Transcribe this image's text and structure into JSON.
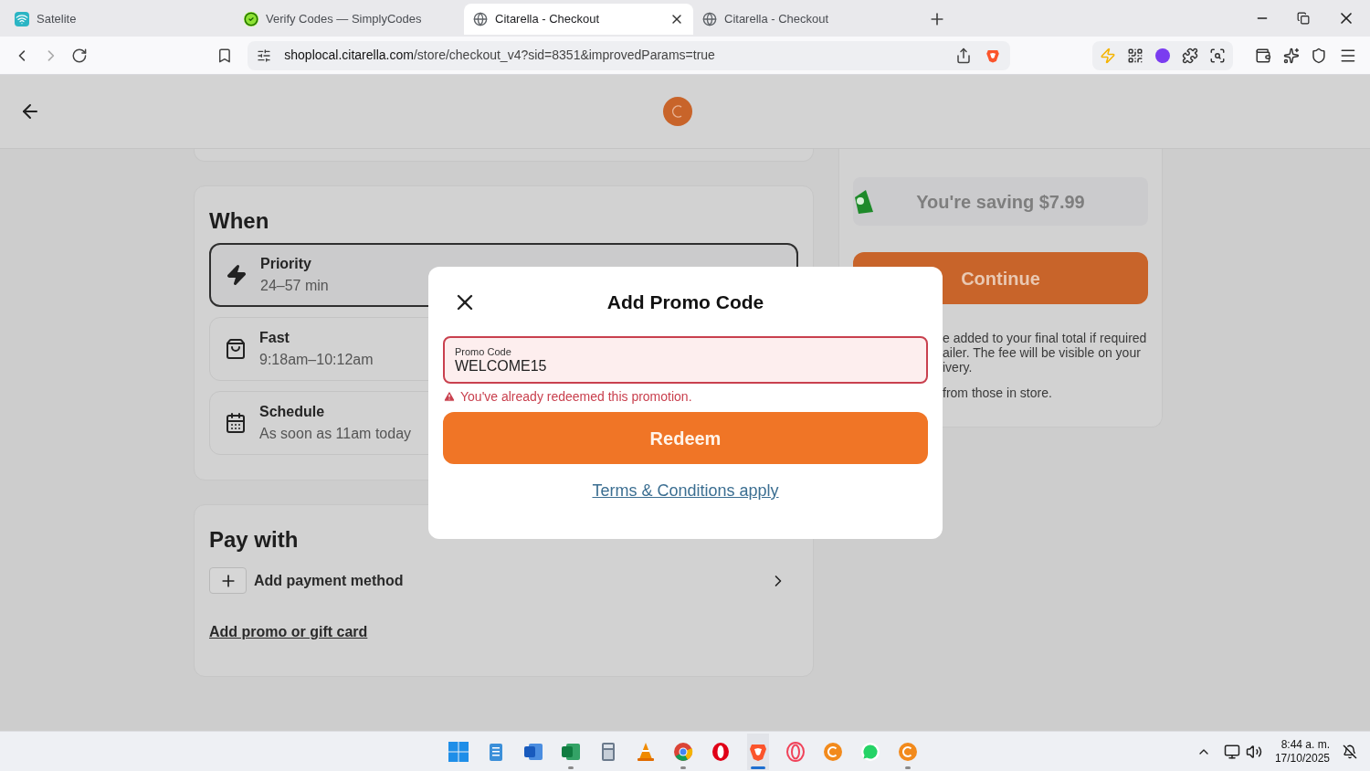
{
  "browser": {
    "tabs": [
      {
        "title": "Satelite",
        "selected": false
      },
      {
        "title": "Verify Codes — SimplyCodes",
        "selected": false
      },
      {
        "title": "Citarella - Checkout",
        "selected": true
      },
      {
        "title": "Citarella - Checkout",
        "selected": false
      }
    ],
    "url_host": "shoplocal.citarella.com",
    "url_path": "/store/checkout_v4?sid=8351&improvedParams=true"
  },
  "when": {
    "title": "When",
    "options": [
      {
        "title": "Priority",
        "subtitle": "24–57 min",
        "selected": true
      },
      {
        "title": "Fast",
        "subtitle": "9:18am–10:12am",
        "selected": false
      },
      {
        "title": "Schedule",
        "subtitle": "As soon as 11am today",
        "selected": false
      }
    ]
  },
  "pay_with": {
    "title": "Pay with",
    "add_payment": "Add payment method",
    "promo_link": "Add promo or gift card"
  },
  "summary": {
    "saving": "You're saving $7.99",
    "continue": "Continue",
    "notes": [
      [
        "e added to your final total if required",
        "ailer. The fee will be visible on your",
        "ivery."
      ],
      [
        "from those in store."
      ]
    ]
  },
  "modal": {
    "title": "Add Promo Code",
    "field_label": "Promo Code",
    "value": "WELCOME15",
    "error": true,
    "error_text": "You've already redeemed this promotion.",
    "button": "Redeem",
    "terms": "Terms & Conditions apply"
  },
  "taskbar": {
    "apps": [
      {
        "open": false,
        "selected": false
      },
      {
        "open": false,
        "selected": false
      },
      {
        "open": true,
        "selected": false
      },
      {
        "open": false,
        "selected": false
      },
      {
        "open": false,
        "selected": false
      },
      {
        "open": true,
        "selected": false
      },
      {
        "open": false,
        "selected": false
      },
      {
        "open": true,
        "selected": true
      },
      {
        "open": false,
        "selected": false
      },
      {
        "open": false,
        "selected": false
      },
      {
        "open": false,
        "selected": false
      },
      {
        "open": true,
        "selected": false
      }
    ],
    "time": "8:44 a. m.",
    "date": "17/10/2025"
  }
}
